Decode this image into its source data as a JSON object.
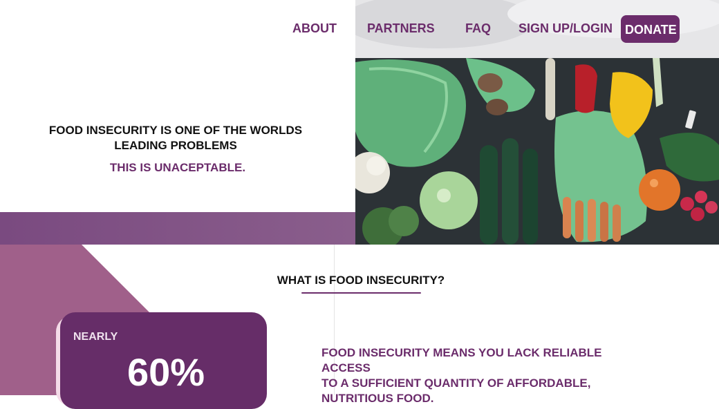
{
  "nav": {
    "links": [
      "ABOUT",
      "PARTNERS",
      "FAQ",
      "SIGN UP/LOGIN"
    ],
    "donate_label": "DONATE"
  },
  "hero": {
    "headline_line1": "FOOD INSECURITY IS ONE OF THE WORLDS",
    "headline_line2": "LEADING PROBLEMS",
    "subline": "THIS IS UNACEPTABLE."
  },
  "section": {
    "title": "WHAT IS FOOD INSECURITY?",
    "definition_line1": "FOOD INSECURITY MEANS YOU LACK RELIABLE ACCESS",
    "definition_line2": "TO A SUFFICIENT QUANTITY OF AFFORDABLE,",
    "definition_line3": "NUTRITIOUS FOOD."
  },
  "stat": {
    "prefix": "NEARLY",
    "value": "60%"
  },
  "colors": {
    "brand_purple": "#6b2c6b",
    "band_purple": "#845888",
    "triangle_mauve": "#a0608a",
    "card_purple": "#662d68"
  },
  "icons": {
    "hero_image": "vegetables-photo"
  }
}
